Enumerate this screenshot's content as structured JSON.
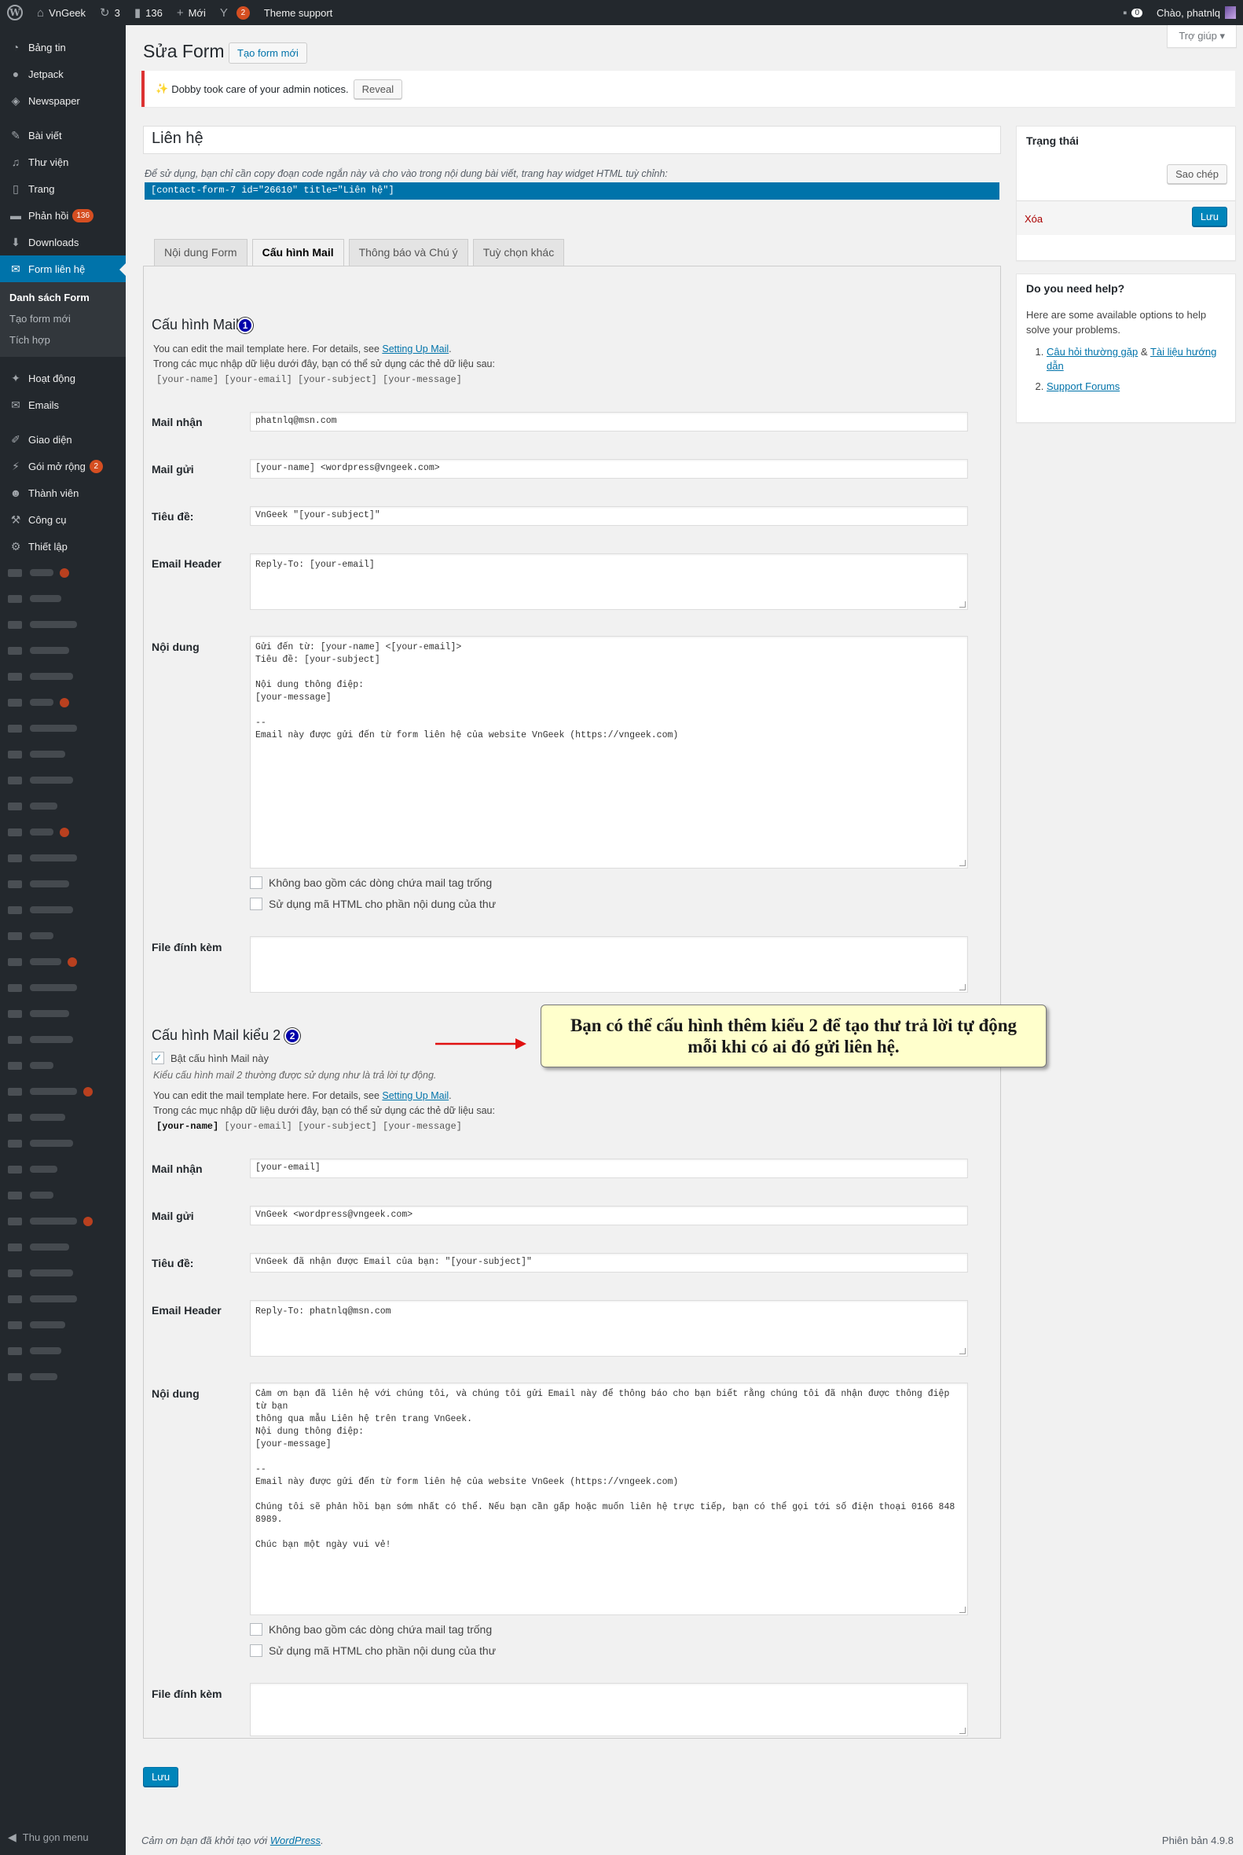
{
  "admin_bar": {
    "site_name": "VnGeek",
    "updates_count": "3",
    "comments_count": "136",
    "new_label": "Mới",
    "yoast_badge": "2",
    "theme_support": "Theme support",
    "notif_count": "0",
    "greeting": "Chào, phatnlq"
  },
  "sidebar": {
    "items": [
      {
        "label": "Bảng tin",
        "icon": "dashboard-icon"
      },
      {
        "label": "Jetpack",
        "icon": "jetpack-icon"
      },
      {
        "label": "Newspaper",
        "icon": "newspaper-icon"
      },
      {
        "label": "Bài viết",
        "icon": "pin-icon"
      },
      {
        "label": "Thư viện",
        "icon": "media-icon"
      },
      {
        "label": "Trang",
        "icon": "page-icon"
      },
      {
        "label": "Phản hồi",
        "icon": "comment-icon",
        "badge": "136"
      },
      {
        "label": "Downloads",
        "icon": "download-icon"
      },
      {
        "label": "Form liên hệ",
        "icon": "mail-icon"
      },
      {
        "label": "Hoạt động",
        "icon": "activity-icon"
      },
      {
        "label": "Emails",
        "icon": "email-icon"
      },
      {
        "label": "Giao diện",
        "icon": "brush-icon"
      },
      {
        "label": "Gói mở rộng",
        "icon": "plugin-icon",
        "badge": "2"
      },
      {
        "label": "Thành viên",
        "icon": "users-icon"
      },
      {
        "label": "Công cụ",
        "icon": "wrench-icon"
      },
      {
        "label": "Thiết lập",
        "icon": "settings-icon"
      }
    ],
    "submenu": [
      "Danh sách Form",
      "Tạo form mới",
      "Tích hợp"
    ],
    "collapse_label": "Thu gọn menu"
  },
  "header": {
    "help_tab": "Trợ giúp",
    "title": "Sửa Form",
    "add_new": "Tạo form mới"
  },
  "notice": {
    "text": "Dobby took care of your admin notices.",
    "button": "Reveal"
  },
  "form": {
    "title_value": "Liên hệ",
    "shortcode_help": "Để sử dụng, bạn chỉ cần copy đoạn code ngắn này và cho vào trong nội dung bài viết, trang hay widget HTML tuỳ chỉnh:",
    "shortcode": "[contact-form-7 id=\"26610\" title=\"Liên hệ\"]"
  },
  "tabs": [
    "Nội dung Form",
    "Cấu hình Mail",
    "Thông báo và Chú ý",
    "Tuỳ chọn khác"
  ],
  "mail1": {
    "title": "Cấu hình Mail",
    "marker": "1",
    "help_line1": "You can edit the mail template here. For details, see ",
    "help_link": "Setting Up Mail",
    "help_line2": "Trong các mục nhập dữ liệu dưới đây, bạn có thể sử dụng các thẻ dữ liệu sau:",
    "tags": "[your-name] [your-email] [your-subject] [your-message]",
    "labels": {
      "to": "Mail nhận",
      "from": "Mail gửi",
      "subject": "Tiêu đề:",
      "headers": "Email Header",
      "body": "Nội dung",
      "attachments": "File đính kèm"
    },
    "to": "phatnlq@msn.com",
    "from": "[your-name] <wordpress@vngeek.com>",
    "subject": "VnGeek \"[your-subject]\"",
    "headers": "Reply-To: [your-email]",
    "body": "Gửi đến từ: [your-name] <[your-email]>\nTiêu đề: [your-subject]\n\nNội dung thông điệp:\n[your-message]\n\n--\nEmail này được gửi đến từ form liên hệ của website VnGeek (https://vngeek.com)",
    "exclude_blank": "Không bao gồm các dòng chứa mail tag trống",
    "use_html": "Sử dụng mã HTML cho phần nội dung của thư"
  },
  "mail2": {
    "title": "Cấu hình Mail kiểu 2",
    "marker": "2",
    "enable_label": "Bật cấu hình Mail này",
    "enable_note": "Kiểu cấu hình mail 2 thường được sử dụng như là trả lời tự động.",
    "help_line1": "You can edit the mail template here. For details, see ",
    "help_link": "Setting Up Mail",
    "help_line2": "Trong các mục nhập dữ liệu dưới đây, bạn có thể sử dụng các thẻ dữ liệu sau:",
    "tag_bold": "[your-name]",
    "tags_rest": " [your-email] [your-subject] [your-message]",
    "to": "[your-email]",
    "from": "VnGeek <wordpress@vngeek.com>",
    "subject": "VnGeek đã nhận được Email của bạn: \"[your-subject]\"",
    "headers": "Reply-To: phatnlq@msn.com",
    "body": "Cảm ơn bạn đã liên hệ với chúng tôi, và chúng tôi gửi Email này để thông báo cho bạn biết rằng chúng tôi đã nhận được thông điệp từ bạn\nthông qua mẫu Liên hệ trên trang VnGeek.\nNội dung thông điệp:\n[your-message]\n\n--\nEmail này được gửi đến từ form liên hệ của website VnGeek (https://vngeek.com)\n\nChúng tôi sẽ phản hồi bạn sớm nhất có thể. Nếu bạn cần gấp hoặc muốn liên hệ trực tiếp, bạn có thể gọi tới số điện thoại 0166 848 8989.\n\nChúc bạn một ngày vui vẻ!",
    "exclude_blank": "Không bao gồm các dòng chứa mail tag trống",
    "use_html": "Sử dụng mã HTML cho phần nội dung của thư"
  },
  "callout": {
    "line1": "Bạn có thể cấu hình thêm kiểu 2 để tạo thư trả lời tự động",
    "line2": "mỗi khi có ai đó gửi liên hệ."
  },
  "save_button": "Lưu",
  "status_box": {
    "title": "Trạng thái",
    "copy": "Sao chép",
    "delete": "Xóa",
    "save": "Lưu"
  },
  "help_box": {
    "title": "Do you need help?",
    "intro": "Here are some available options to help solve your problems.",
    "faq": "Câu hỏi thường gặp",
    "amp": "&",
    "docs": "Tài liệu hướng dẫn",
    "forums": "Support Forums"
  },
  "footer": {
    "thanks": "Cảm ơn bạn đã khởi tạo với ",
    "wp_link": "WordPress",
    "dot": ".",
    "version": "Phiên bản 4.9.8"
  },
  "colors": {
    "admin_bg": "#23282d",
    "accent": "#0073aa",
    "primary_button": "#0085ba",
    "badge": "#d54e21",
    "callout_bg": "#ffffcc",
    "arrow": "#e01010"
  }
}
